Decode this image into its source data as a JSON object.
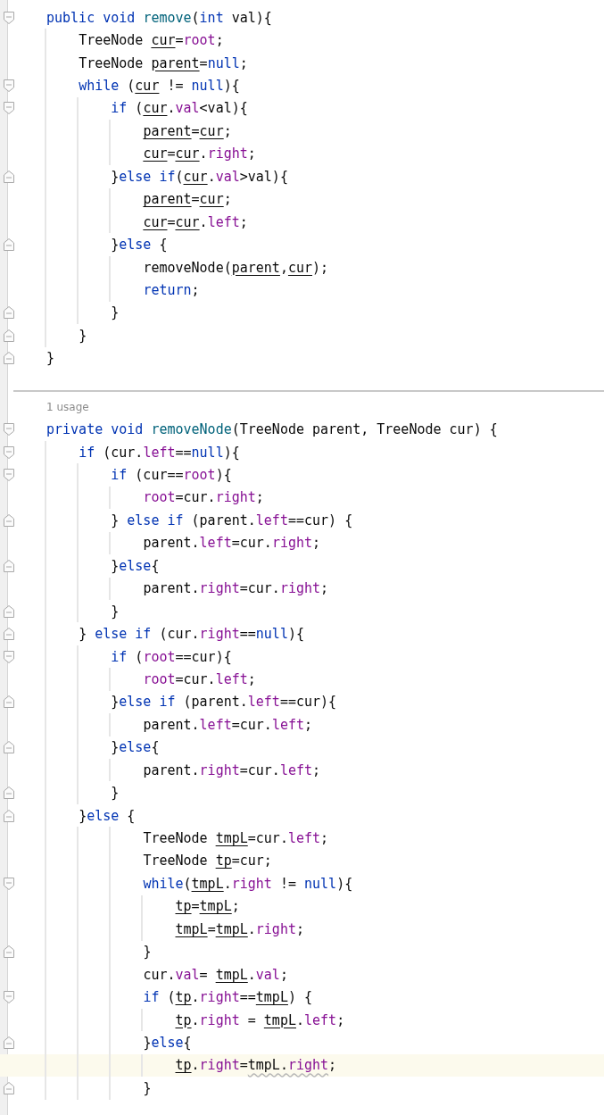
{
  "sections": [
    {
      "lines": [
        {
          "fold": {
            "kind": "start"
          },
          "tokens": [
            {
              "text": "public void ",
              "kind": "keyword"
            },
            {
              "text": "remove",
              "kind": "method"
            },
            {
              "text": "(",
              "kind": "plain"
            },
            {
              "text": "int",
              "kind": "keyword"
            },
            {
              "text": " val){",
              "kind": "plain"
            }
          ]
        },
        {
          "tokens": [
            {
              "text": "    TreeNode ",
              "kind": "plain"
            },
            {
              "text": "cur",
              "kind": "local"
            },
            {
              "text": "=",
              "kind": "plain"
            },
            {
              "text": "root",
              "kind": "field"
            },
            {
              "text": ";",
              "kind": "plain"
            }
          ]
        },
        {
          "tokens": [
            {
              "text": "    TreeNode ",
              "kind": "plain"
            },
            {
              "text": "parent",
              "kind": "local"
            },
            {
              "text": "=",
              "kind": "plain"
            },
            {
              "text": "null",
              "kind": "keyword"
            },
            {
              "text": ";",
              "kind": "plain"
            }
          ]
        },
        {
          "fold": {
            "kind": "start"
          },
          "tokens": [
            {
              "text": "    while",
              "kind": "keyword"
            },
            {
              "text": " (",
              "kind": "plain"
            },
            {
              "text": "cur",
              "kind": "local"
            },
            {
              "text": " != ",
              "kind": "plain"
            },
            {
              "text": "null",
              "kind": "keyword"
            },
            {
              "text": "){",
              "kind": "plain"
            }
          ]
        },
        {
          "fold": {
            "kind": "start"
          },
          "tokens": [
            {
              "text": "        if",
              "kind": "keyword"
            },
            {
              "text": " (",
              "kind": "plain"
            },
            {
              "text": "cur",
              "kind": "local"
            },
            {
              "text": ".",
              "kind": "plain"
            },
            {
              "text": "val",
              "kind": "field"
            },
            {
              "text": "<val){",
              "kind": "plain"
            }
          ]
        },
        {
          "tokens": [
            {
              "text": "            parent",
              "kind": "local"
            },
            {
              "text": "=",
              "kind": "plain"
            },
            {
              "text": "cur",
              "kind": "local"
            },
            {
              "text": ";",
              "kind": "plain"
            }
          ]
        },
        {
          "tokens": [
            {
              "text": "            cur",
              "kind": "local"
            },
            {
              "text": "=",
              "kind": "plain"
            },
            {
              "text": "cur",
              "kind": "local"
            },
            {
              "text": ".",
              "kind": "plain"
            },
            {
              "text": "right",
              "kind": "field"
            },
            {
              "text": ";",
              "kind": "plain"
            }
          ]
        },
        {
          "fold": {
            "kind": "end"
          },
          "tokens": [
            {
              "text": "        }",
              "kind": "plain"
            },
            {
              "text": "else if",
              "kind": "keyword"
            },
            {
              "text": "(",
              "kind": "plain"
            },
            {
              "text": "cur",
              "kind": "local"
            },
            {
              "text": ".",
              "kind": "plain"
            },
            {
              "text": "val",
              "kind": "field"
            },
            {
              "text": ">val){",
              "kind": "plain"
            }
          ]
        },
        {
          "tokens": [
            {
              "text": "            parent",
              "kind": "local"
            },
            {
              "text": "=",
              "kind": "plain"
            },
            {
              "text": "cur",
              "kind": "local"
            },
            {
              "text": ";",
              "kind": "plain"
            }
          ]
        },
        {
          "tokens": [
            {
              "text": "            cur",
              "kind": "local"
            },
            {
              "text": "=",
              "kind": "plain"
            },
            {
              "text": "cur",
              "kind": "local"
            },
            {
              "text": ".",
              "kind": "plain"
            },
            {
              "text": "left",
              "kind": "field"
            },
            {
              "text": ";",
              "kind": "plain"
            }
          ]
        },
        {
          "fold": {
            "kind": "end"
          },
          "tokens": [
            {
              "text": "        }",
              "kind": "plain"
            },
            {
              "text": "else",
              "kind": "keyword"
            },
            {
              "text": " {",
              "kind": "plain"
            }
          ]
        },
        {
          "tokens": [
            {
              "text": "            removeNode(",
              "kind": "plain"
            },
            {
              "text": "parent",
              "kind": "local"
            },
            {
              "text": ",",
              "kind": "plain"
            },
            {
              "text": "cur",
              "kind": "local"
            },
            {
              "text": ");",
              "kind": "plain"
            }
          ]
        },
        {
          "tokens": [
            {
              "text": "            return",
              "kind": "keyword"
            },
            {
              "text": ";",
              "kind": "plain"
            }
          ]
        },
        {
          "fold": {
            "kind": "end"
          },
          "tokens": [
            {
              "text": "        }",
              "kind": "plain"
            }
          ]
        },
        {
          "fold": {
            "kind": "end"
          },
          "tokens": [
            {
              "text": "    }",
              "kind": "plain"
            }
          ]
        },
        {
          "fold": {
            "kind": "end"
          },
          "tokens": [
            {
              "text": "}",
              "kind": "plain"
            }
          ]
        }
      ]
    },
    {
      "usage": "1 usage",
      "lines": [
        {
          "fold": {
            "kind": "start"
          },
          "tokens": [
            {
              "text": "private void ",
              "kind": "keyword"
            },
            {
              "text": "removeNode",
              "kind": "method"
            },
            {
              "text": "(TreeNode parent, TreeNode cur) {",
              "kind": "plain"
            }
          ]
        },
        {
          "fold": {
            "kind": "start"
          },
          "tokens": [
            {
              "text": "    if",
              "kind": "keyword"
            },
            {
              "text": " (cur.",
              "kind": "plain"
            },
            {
              "text": "left",
              "kind": "field"
            },
            {
              "text": "==",
              "kind": "plain"
            },
            {
              "text": "null",
              "kind": "keyword"
            },
            {
              "text": "){",
              "kind": "plain"
            }
          ]
        },
        {
          "fold": {
            "kind": "start"
          },
          "tokens": [
            {
              "text": "        if",
              "kind": "keyword"
            },
            {
              "text": " (cur==",
              "kind": "plain"
            },
            {
              "text": "root",
              "kind": "field"
            },
            {
              "text": "){",
              "kind": "plain"
            }
          ]
        },
        {
          "tokens": [
            {
              "text": "            root",
              "kind": "field"
            },
            {
              "text": "=cur.",
              "kind": "plain"
            },
            {
              "text": "right",
              "kind": "field"
            },
            {
              "text": ";",
              "kind": "plain"
            }
          ]
        },
        {
          "fold": {
            "kind": "end"
          },
          "tokens": [
            {
              "text": "        } ",
              "kind": "plain"
            },
            {
              "text": "else if",
              "kind": "keyword"
            },
            {
              "text": " (parent.",
              "kind": "plain"
            },
            {
              "text": "left",
              "kind": "field"
            },
            {
              "text": "==cur) {",
              "kind": "plain"
            }
          ]
        },
        {
          "tokens": [
            {
              "text": "            parent.",
              "kind": "plain"
            },
            {
              "text": "left",
              "kind": "field"
            },
            {
              "text": "=cur.",
              "kind": "plain"
            },
            {
              "text": "right",
              "kind": "field"
            },
            {
              "text": ";",
              "kind": "plain"
            }
          ]
        },
        {
          "fold": {
            "kind": "end"
          },
          "tokens": [
            {
              "text": "        }",
              "kind": "plain"
            },
            {
              "text": "else",
              "kind": "keyword"
            },
            {
              "text": "{",
              "kind": "plain"
            }
          ]
        },
        {
          "tokens": [
            {
              "text": "            parent.",
              "kind": "plain"
            },
            {
              "text": "right",
              "kind": "field"
            },
            {
              "text": "=cur.",
              "kind": "plain"
            },
            {
              "text": "right",
              "kind": "field"
            },
            {
              "text": ";",
              "kind": "plain"
            }
          ]
        },
        {
          "fold": {
            "kind": "end"
          },
          "tokens": [
            {
              "text": "        }",
              "kind": "plain"
            }
          ]
        },
        {
          "fold": {
            "kind": "end"
          },
          "tokens": [
            {
              "text": "    } ",
              "kind": "plain"
            },
            {
              "text": "else if",
              "kind": "keyword"
            },
            {
              "text": " (cur.",
              "kind": "plain"
            },
            {
              "text": "right",
              "kind": "field"
            },
            {
              "text": "==",
              "kind": "plain"
            },
            {
              "text": "null",
              "kind": "keyword"
            },
            {
              "text": "){",
              "kind": "plain"
            }
          ]
        },
        {
          "fold": {
            "kind": "start"
          },
          "tokens": [
            {
              "text": "        if",
              "kind": "keyword"
            },
            {
              "text": " (",
              "kind": "plain"
            },
            {
              "text": "root",
              "kind": "field"
            },
            {
              "text": "==cur){",
              "kind": "plain"
            }
          ]
        },
        {
          "tokens": [
            {
              "text": "            root",
              "kind": "field"
            },
            {
              "text": "=cur.",
              "kind": "plain"
            },
            {
              "text": "left",
              "kind": "field"
            },
            {
              "text": ";",
              "kind": "plain"
            }
          ]
        },
        {
          "fold": {
            "kind": "end"
          },
          "tokens": [
            {
              "text": "        }",
              "kind": "plain"
            },
            {
              "text": "else if",
              "kind": "keyword"
            },
            {
              "text": " (parent.",
              "kind": "plain"
            },
            {
              "text": "left",
              "kind": "field"
            },
            {
              "text": "==cur){",
              "kind": "plain"
            }
          ]
        },
        {
          "tokens": [
            {
              "text": "            parent.",
              "kind": "plain"
            },
            {
              "text": "left",
              "kind": "field"
            },
            {
              "text": "=cur.",
              "kind": "plain"
            },
            {
              "text": "left",
              "kind": "field"
            },
            {
              "text": ";",
              "kind": "plain"
            }
          ]
        },
        {
          "fold": {
            "kind": "end"
          },
          "tokens": [
            {
              "text": "        }",
              "kind": "plain"
            },
            {
              "text": "else",
              "kind": "keyword"
            },
            {
              "text": "{",
              "kind": "plain"
            }
          ]
        },
        {
          "tokens": [
            {
              "text": "            parent.",
              "kind": "plain"
            },
            {
              "text": "right",
              "kind": "field"
            },
            {
              "text": "=cur.",
              "kind": "plain"
            },
            {
              "text": "left",
              "kind": "field"
            },
            {
              "text": ";",
              "kind": "plain"
            }
          ]
        },
        {
          "fold": {
            "kind": "end"
          },
          "tokens": [
            {
              "text": "        }",
              "kind": "plain"
            }
          ]
        },
        {
          "fold": {
            "kind": "end"
          },
          "tokens": [
            {
              "text": "    }",
              "kind": "plain"
            },
            {
              "text": "else",
              "kind": "keyword"
            },
            {
              "text": " {",
              "kind": "plain"
            }
          ]
        },
        {
          "tokens": [
            {
              "text": "            TreeNode ",
              "kind": "plain"
            },
            {
              "text": "tmpL",
              "kind": "local"
            },
            {
              "text": "=cur.",
              "kind": "plain"
            },
            {
              "text": "left",
              "kind": "field"
            },
            {
              "text": ";",
              "kind": "plain"
            }
          ]
        },
        {
          "tokens": [
            {
              "text": "            TreeNode ",
              "kind": "plain"
            },
            {
              "text": "tp",
              "kind": "local"
            },
            {
              "text": "=cur;",
              "kind": "plain"
            }
          ]
        },
        {
          "fold": {
            "kind": "start"
          },
          "tokens": [
            {
              "text": "            while",
              "kind": "keyword"
            },
            {
              "text": "(",
              "kind": "plain"
            },
            {
              "text": "tmpL",
              "kind": "local"
            },
            {
              "text": ".",
              "kind": "plain"
            },
            {
              "text": "right",
              "kind": "field"
            },
            {
              "text": " != ",
              "kind": "plain"
            },
            {
              "text": "null",
              "kind": "keyword"
            },
            {
              "text": "){",
              "kind": "plain"
            }
          ]
        },
        {
          "tokens": [
            {
              "text": "                tp",
              "kind": "local"
            },
            {
              "text": "=",
              "kind": "plain"
            },
            {
              "text": "tmpL",
              "kind": "local"
            },
            {
              "text": ";",
              "kind": "plain"
            }
          ]
        },
        {
          "tokens": [
            {
              "text": "                tmpL",
              "kind": "local"
            },
            {
              "text": "=",
              "kind": "plain"
            },
            {
              "text": "tmpL",
              "kind": "local"
            },
            {
              "text": ".",
              "kind": "plain"
            },
            {
              "text": "right",
              "kind": "field"
            },
            {
              "text": ";",
              "kind": "plain"
            }
          ]
        },
        {
          "fold": {
            "kind": "end"
          },
          "tokens": [
            {
              "text": "            }",
              "kind": "plain"
            }
          ]
        },
        {
          "tokens": [
            {
              "text": "            cur.",
              "kind": "plain"
            },
            {
              "text": "val",
              "kind": "field"
            },
            {
              "text": "= ",
              "kind": "plain"
            },
            {
              "text": "tmpL",
              "kind": "local"
            },
            {
              "text": ".",
              "kind": "plain"
            },
            {
              "text": "val",
              "kind": "field"
            },
            {
              "text": ";",
              "kind": "plain"
            }
          ]
        },
        {
          "fold": {
            "kind": "start"
          },
          "tokens": [
            {
              "text": "            if",
              "kind": "keyword"
            },
            {
              "text": " (",
              "kind": "plain"
            },
            {
              "text": "tp",
              "kind": "local"
            },
            {
              "text": ".",
              "kind": "plain"
            },
            {
              "text": "right",
              "kind": "field"
            },
            {
              "text": "==",
              "kind": "plain"
            },
            {
              "text": "tmpL",
              "kind": "local"
            },
            {
              "text": ") {",
              "kind": "plain"
            }
          ]
        },
        {
          "tokens": [
            {
              "text": "                tp",
              "kind": "local"
            },
            {
              "text": ".",
              "kind": "plain"
            },
            {
              "text": "right",
              "kind": "field"
            },
            {
              "text": " = ",
              "kind": "plain"
            },
            {
              "text": "tmpL",
              "kind": "local"
            },
            {
              "text": ".",
              "kind": "plain"
            },
            {
              "text": "left",
              "kind": "field"
            },
            {
              "text": ";",
              "kind": "plain"
            }
          ]
        },
        {
          "fold": {
            "kind": "end"
          },
          "tokens": [
            {
              "text": "            }",
              "kind": "plain"
            },
            {
              "text": "else",
              "kind": "keyword"
            },
            {
              "text": "{",
              "kind": "plain"
            }
          ]
        },
        {
          "current": true,
          "tokens": [
            {
              "text": "                tp",
              "kind": "local"
            },
            {
              "text": ".",
              "kind": "plain"
            },
            {
              "text": "right",
              "kind": "field"
            },
            {
              "text": "=",
              "kind": "plain"
            },
            {
              "text": "tmpL.",
              "kind": "warn"
            },
            {
              "text": "right",
              "kind": "warn-field"
            },
            {
              "text": ";",
              "kind": "plain"
            }
          ]
        },
        {
          "fold": {
            "kind": "end"
          },
          "tokens": [
            {
              "text": "            }",
              "kind": "plain"
            }
          ]
        }
      ]
    }
  ]
}
